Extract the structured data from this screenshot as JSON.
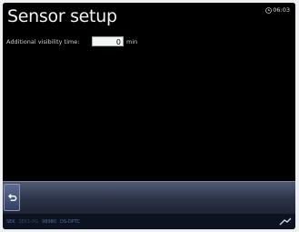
{
  "header": {
    "title": "Sensor setup",
    "clock": "06:03"
  },
  "settings": {
    "visibility_label": "Additional visibility time:",
    "visibility_value": "0",
    "visibility_unit": "min"
  },
  "toolbar": {
    "back_icon": "back-arrow-icon"
  },
  "statusbar": {
    "items": [
      "SEK",
      "SEK1-PG",
      "98980",
      "DS-DPTC"
    ]
  },
  "colors": {
    "background": "#000000",
    "toolbar": "#2c3347",
    "status_text": "#4f6ea0"
  }
}
